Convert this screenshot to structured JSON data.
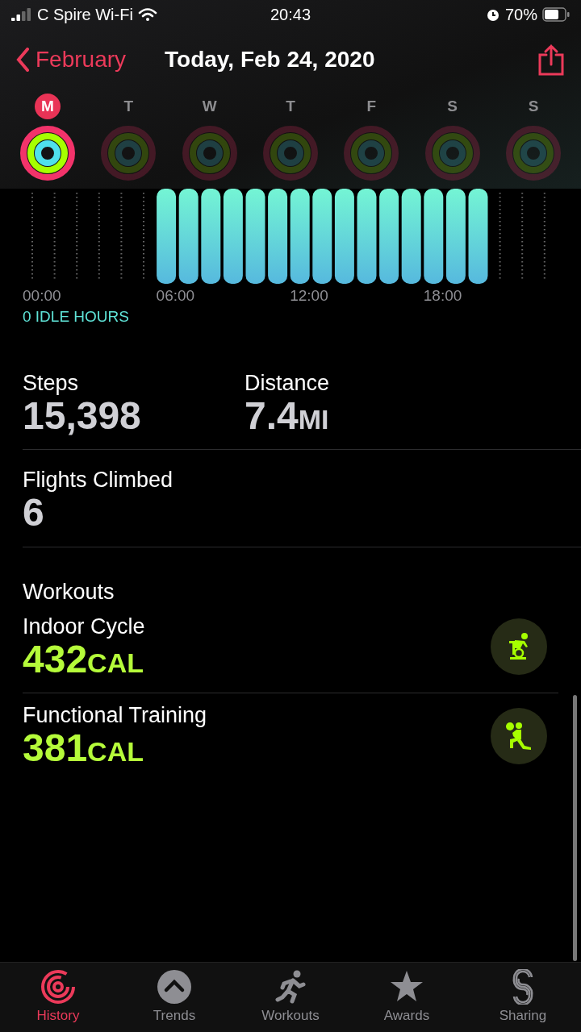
{
  "status_bar": {
    "carrier": "C Spire Wi-Fi",
    "time": "20:43",
    "battery": "70%"
  },
  "nav": {
    "back": "February",
    "title": "Today, Feb 24, 2020"
  },
  "days": [
    {
      "letter": "M",
      "selected": true,
      "closed": true
    },
    {
      "letter": "T",
      "selected": false,
      "closed": false
    },
    {
      "letter": "W",
      "selected": false,
      "closed": false
    },
    {
      "letter": "T",
      "selected": false,
      "closed": false
    },
    {
      "letter": "F",
      "selected": false,
      "closed": false
    },
    {
      "letter": "S",
      "selected": false,
      "closed": false
    },
    {
      "letter": "S",
      "selected": false,
      "closed": false
    }
  ],
  "stand_chart": {
    "hours": [
      false,
      false,
      false,
      false,
      false,
      false,
      true,
      true,
      true,
      true,
      true,
      true,
      true,
      true,
      true,
      true,
      true,
      true,
      true,
      true,
      true,
      false,
      false,
      false
    ],
    "time_labels": [
      "00:00",
      "06:00",
      "12:00",
      "18:00"
    ],
    "idle": "0 IDLE HOURS"
  },
  "stats": [
    {
      "label": "Steps",
      "value": "15,398"
    },
    {
      "label": "Distance",
      "value": "7.4",
      "unit": "MI"
    }
  ],
  "flights": {
    "label": "Flights Climbed",
    "value": "6"
  },
  "workouts": {
    "heading": "Workouts",
    "items": [
      {
        "name": "Indoor Cycle",
        "value": "432",
        "unit": "CAL",
        "kind": "cycle"
      },
      {
        "name": "Functional Training",
        "value": "381",
        "unit": "CAL",
        "kind": "functional"
      }
    ]
  },
  "tabs": [
    {
      "label": "History",
      "selected": true,
      "kind": "history"
    },
    {
      "label": "Trends",
      "selected": false,
      "kind": "trends"
    },
    {
      "label": "Workouts",
      "selected": false,
      "kind": "workouts"
    },
    {
      "label": "Awards",
      "selected": false,
      "kind": "awards"
    },
    {
      "label": "Sharing",
      "selected": false,
      "kind": "sharing"
    }
  ]
}
